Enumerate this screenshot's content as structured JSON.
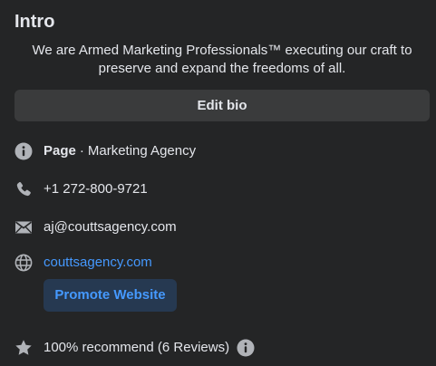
{
  "intro": {
    "title": "Intro",
    "bio": "We are Armed Marketing Professionals™ executing our craft to preserve and expand the freedoms of all.",
    "edit_bio_label": "Edit bio"
  },
  "details": {
    "page_label": "Page",
    "separator": "·",
    "category": "Marketing Agency",
    "phone": "+1 272-800-9721",
    "email": "aj@couttsagency.com",
    "website": "couttsagency.com",
    "promote_label": "Promote Website",
    "recommend": "100% recommend (6 Reviews)"
  },
  "icons": {
    "info": "info-icon",
    "phone": "phone-icon",
    "email": "mail-icon",
    "website": "globe-icon",
    "rating": "star-icon"
  },
  "colors": {
    "background": "#242526",
    "text": "#e4e6eb",
    "secondary": "#b0b3b8",
    "link": "#4599ff",
    "button": "#3a3b3c",
    "promote_bg": "#263951"
  }
}
